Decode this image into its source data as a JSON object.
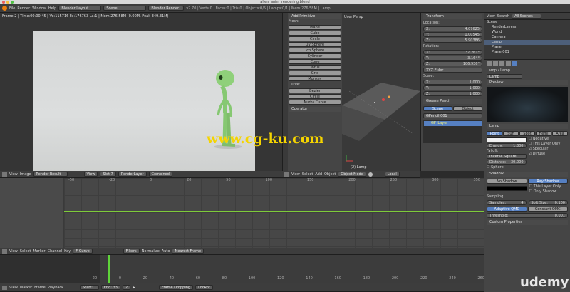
{
  "title_bar": {
    "title": "alien_anim_rendering.blend"
  },
  "top_header": {
    "menus": [
      "File",
      "Render",
      "Window",
      "Help"
    ],
    "layout": "Blender Layout",
    "scene": "Scene",
    "engine": "Blender Render",
    "stats": "v2.70 | Verts:0 | Faces:0 | Tris:0 | Objects:0/5 | Lamps:0/1 | Mem:276.58M | Lamp"
  },
  "render_view": {
    "info": "Frame:2 | Time:00:00.45 | Ve:115716 Fa:176763 La:1 | Mem:276.58M (0.00M, Peak 349.31M)",
    "header": {
      "items": [
        "View",
        "Image"
      ],
      "image_name": "Render Result",
      "view": "View",
      "slot": "Slot 7",
      "layer": "RenderLayer",
      "pass": "Combined"
    }
  },
  "tool_shelf": {
    "add_primitive": "Add Primitive",
    "mesh_label": "Mesh:",
    "mesh_items": [
      "Plane",
      "Cube",
      "Circle",
      "UV Sphere",
      "Ico Sphere",
      "Cylinder",
      "Cone",
      "Torus",
      "Grid",
      "Monkey"
    ],
    "curve_label": "Curve:",
    "curve_items": [
      "Bezier",
      "Circle",
      "Nurbs Curve"
    ],
    "operator": "Operator",
    "tabs": [
      "Tools",
      "Create",
      "Relations",
      "Animation",
      "Physics",
      "Grease Pencil"
    ]
  },
  "viewport": {
    "label": "User Persp",
    "object_label": "(2) Lamp",
    "header": {
      "items": [
        "View",
        "Select",
        "Add",
        "Object"
      ],
      "mode": "Object Mode",
      "orientation": "Local"
    }
  },
  "properties_n": {
    "transform": "Transform",
    "location": "Location:",
    "loc": [
      {
        "axis": "X:",
        "value": "4.07625"
      },
      {
        "axis": "Y:",
        "value": "1.00545"
      },
      {
        "axis": "Z:",
        "value": "5.90386"
      }
    ],
    "rotation": "Rotation:",
    "rot": [
      {
        "axis": "X:",
        "value": "37.261°"
      },
      {
        "axis": "Y:",
        "value": "3.164°"
      },
      {
        "axis": "Z:",
        "value": "106.936°"
      }
    ],
    "rot_mode": "XYZ Euler",
    "scale": "Scale:",
    "scl": [
      {
        "axis": "X:",
        "value": "1.000"
      },
      {
        "axis": "Y:",
        "value": "1.000"
      },
      {
        "axis": "Z:",
        "value": "1.000"
      }
    ],
    "grease_pencil": "Grease Pencil",
    "gp_tabs": [
      "Scene",
      "Object"
    ],
    "gp_name": "GPencil.001",
    "gp_layer": "GP_Layer"
  },
  "outliner": {
    "header": {
      "items": [
        "View",
        "Search"
      ],
      "filter": "All Scenes"
    },
    "items": [
      "Scene",
      "RenderLayers",
      "World",
      "Camera",
      "Lamp",
      "Plane",
      "Plane.001"
    ]
  },
  "properties": {
    "breadcrumb": [
      "Lamp",
      "Lamp"
    ],
    "datablock": "Lamp",
    "preview": "Preview",
    "lamp_section": "Lamp",
    "lamp_types": [
      "Point",
      "Sun",
      "Spot",
      "Hemi",
      "Area"
    ],
    "energy_label": "Energy:",
    "energy_value": "1.300",
    "falloff_label": "Falloff:",
    "falloff_value": "Inverse Square",
    "distance_label": "Distance:",
    "distance_value": "30.000",
    "negative": "Negative",
    "this_layer_only": "This Layer Only",
    "specular": "Specular",
    "diffuse": "Diffuse",
    "sphere": "Sphere",
    "shadow_section": "Shadow",
    "shadow_types": [
      "No Shadow",
      "Ray Shadow"
    ],
    "this_layer_only_shadow": "This Layer Only",
    "only_shadow": "Only Shadow",
    "sampling": "Sampling:",
    "samples_label": "Samples:",
    "samples_value": "4",
    "soft_size_label": "Soft Size:",
    "soft_size_value": "0.100",
    "qmc_types": [
      "Adaptive QMC",
      "Constant QMC"
    ],
    "threshold_label": "Threshold:",
    "threshold_value": "0.001",
    "custom_properties": "Custom Properties"
  },
  "graph_editor": {
    "header": {
      "items": [
        "View",
        "Select",
        "Marker",
        "Channel",
        "Key"
      ],
      "mode": "F-Curve",
      "filters": "Filters",
      "normalize": "Normalize",
      "auto": "Auto",
      "snap": "Nearest Frame"
    },
    "frame_labels": [
      "-50",
      "-20",
      "0",
      "20",
      "50",
      "100",
      "150",
      "200",
      "250",
      "300",
      "350"
    ]
  },
  "timeline": {
    "header": {
      "items": [
        "View",
        "Marker",
        "Frame",
        "Playback"
      ],
      "start_label": "Start:",
      "start_value": "1",
      "end_label": "End:",
      "end_value": "33",
      "current": "2",
      "sync": "Frame Dropping",
      "keying": "LocRot"
    },
    "frame_labels": [
      "-20",
      "0",
      "20",
      "40",
      "60",
      "80",
      "100",
      "120",
      "140",
      "160",
      "180",
      "200",
      "220",
      "240",
      "260"
    ]
  },
  "watermark": {
    "text": "www.cg-ku.com",
    "brand": "udemy"
  },
  "colors": {
    "accent": "#5680c2",
    "curve": "#7ecb3a",
    "playhead": "#5fd43a",
    "alien": "#8fd07a"
  }
}
